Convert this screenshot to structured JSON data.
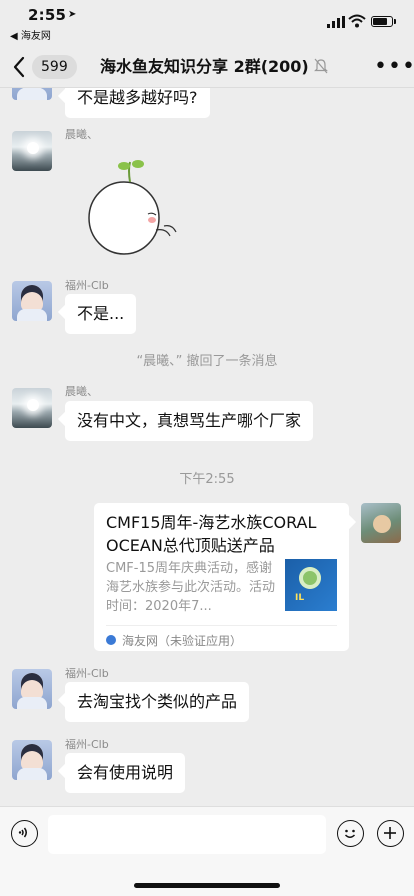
{
  "status_bar": {
    "time": "2:55",
    "back_to_app": "◀ 海友网",
    "battery_level": 0.75
  },
  "nav": {
    "unread_count": "599",
    "title": "海水鱼友知识分享 2群(200)"
  },
  "messages": [
    {
      "text": "不是越多越好吗?"
    },
    {
      "sender": "晨曦、",
      "sticker": "shy-bun-sticker"
    },
    {
      "sender": "福州-Clb",
      "text": "不是..."
    },
    {
      "system": "“晨曦、” 撤回了一条消息"
    },
    {
      "sender": "晨曦、",
      "text": "没有中文，真想骂生产哪个厂家"
    },
    {
      "timestamp": "下午2:55"
    },
    {
      "sender": "福州-Clb",
      "text": "去淘宝找个类似的产品"
    },
    {
      "sender": "福州-Clb",
      "text": "会有使用说明"
    }
  ],
  "link_card": {
    "title": "CMF15周年-海艺水族CORAL OCEAN总代顶贴送产品",
    "description": "CMF-15周年庆典活动，感谢海艺水族参与此次活动。活动时间：2020年7...",
    "source": "海友网（未验证应用）"
  },
  "colors": {
    "background": "#ededed",
    "bubble": "#ffffff",
    "muted_text": "#999999"
  }
}
